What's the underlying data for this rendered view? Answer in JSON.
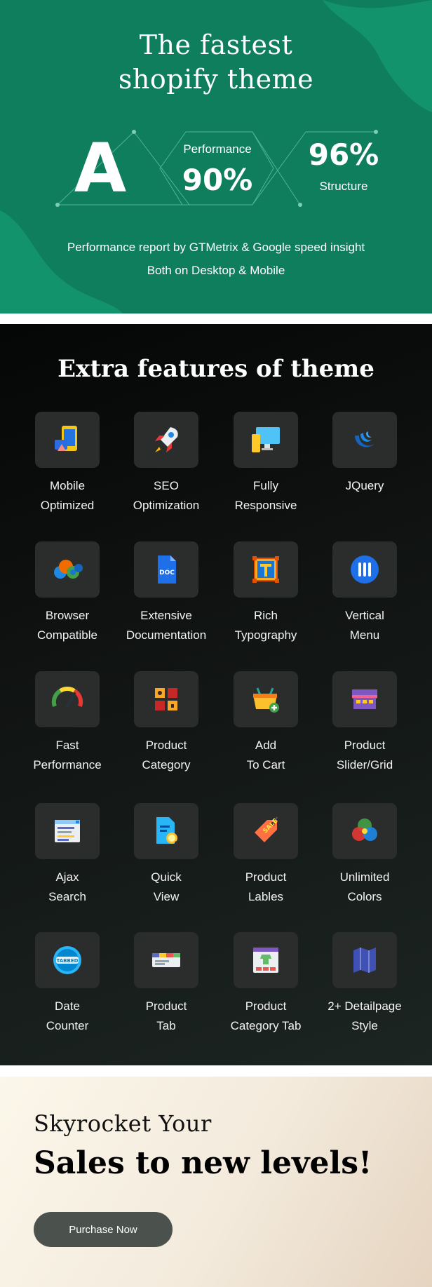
{
  "hero": {
    "title_line1": "The fastest",
    "title_line2": "shopify theme",
    "grade": "A",
    "performance_label": "Performance",
    "performance_value": "90%",
    "structure_value": "96%",
    "structure_label": "Structure",
    "desc_line1": "Performance report by GTMetrix & Google speed insight",
    "desc_line2": "Both on Desktop & Mobile",
    "colors": {
      "background": "#0f7e5d",
      "blob": "#13936b"
    }
  },
  "features": {
    "title": "Extra features of theme",
    "items": [
      {
        "icon": "mobile-icon",
        "label": "Mobile\nOptimized"
      },
      {
        "icon": "rocket-icon",
        "label": "SEO\nOptimization"
      },
      {
        "icon": "responsive-devices-icon",
        "label": "Fully\nResponsive"
      },
      {
        "icon": "jquery-icon",
        "label": "JQuery"
      },
      {
        "icon": "browsers-icon",
        "label": "Browser\nCompatible"
      },
      {
        "icon": "doc-icon",
        "label": "Extensive\nDocumentation"
      },
      {
        "icon": "typography-icon",
        "label": "Rich\nTypography"
      },
      {
        "icon": "vertical-menu-icon",
        "label": "Vertical\nMenu"
      },
      {
        "icon": "speedometer-icon",
        "label": "Fast\nPerformance"
      },
      {
        "icon": "category-grid-icon",
        "label": "Product\nCategory"
      },
      {
        "icon": "basket-icon",
        "label": "Add\nTo Cart"
      },
      {
        "icon": "storefront-icon",
        "label": "Product\nSlider/Grid"
      },
      {
        "icon": "search-window-icon",
        "label": "Ajax\nSearch"
      },
      {
        "icon": "document-search-icon",
        "label": "Quick\nView"
      },
      {
        "icon": "price-tag-icon",
        "label": "Product\nLables"
      },
      {
        "icon": "color-circles-icon",
        "label": "Unlimited\nColors"
      },
      {
        "icon": "tabbed-badge-icon",
        "label": "Date\nCounter"
      },
      {
        "icon": "product-tab-icon",
        "label": "Product\nTab"
      },
      {
        "icon": "category-tab-icon",
        "label": "Product\nCategory Tab"
      },
      {
        "icon": "map-pages-icon",
        "label": "2+ Detailpage\nStyle"
      }
    ]
  },
  "cta": {
    "line1": "Skyrocket Your",
    "line2": "Sales to new levels!",
    "button_label": "Purchase Now"
  }
}
